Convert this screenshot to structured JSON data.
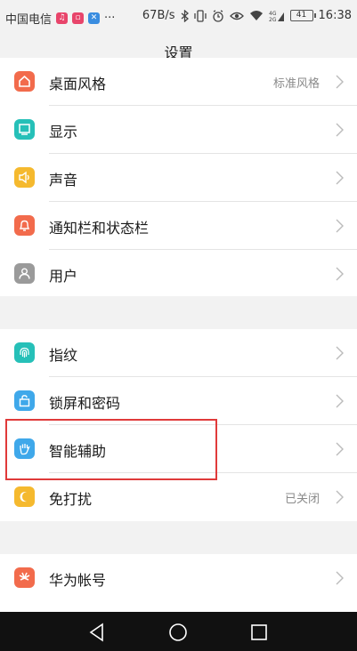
{
  "status_bar": {
    "carrier": "中国电信",
    "app_badges": [
      {
        "icon": "music-app-icon",
        "color": "#e8456b",
        "glyph": "♫"
      },
      {
        "icon": "camera-app-icon",
        "color": "#e8456b",
        "glyph": "▫"
      },
      {
        "icon": "tools-app-icon",
        "color": "#3a8de0",
        "glyph": "✕"
      }
    ],
    "more": "···",
    "net_speed": "67B/s",
    "battery_level": "41",
    "time": "16:38"
  },
  "header": {
    "title": "设置"
  },
  "groups": [
    {
      "items": [
        {
          "label": "桌面风格",
          "value": "标准风格",
          "icon": "home-icon",
          "color": "#f26b4c"
        },
        {
          "label": "显示",
          "value": "",
          "icon": "display-icon",
          "color": "#26c0b8"
        },
        {
          "label": "声音",
          "value": "",
          "icon": "speaker-icon",
          "color": "#f5b92e"
        },
        {
          "label": "通知栏和状态栏",
          "value": "",
          "icon": "bell-icon",
          "color": "#f26b4c"
        },
        {
          "label": "用户",
          "value": "",
          "icon": "user-icon",
          "color": "#9a9a9a"
        }
      ]
    },
    {
      "items": [
        {
          "label": "指纹",
          "value": "",
          "icon": "fingerprint-icon",
          "color": "#26c0b8"
        },
        {
          "label": "锁屏和密码",
          "value": "",
          "icon": "lock-icon",
          "color": "#3fa8ea"
        },
        {
          "label": "智能辅助",
          "value": "",
          "icon": "hand-icon",
          "color": "#3fa8ea"
        },
        {
          "label": "免打扰",
          "value": "已关闭",
          "icon": "moon-icon",
          "color": "#f5b92e"
        }
      ]
    },
    {
      "items": [
        {
          "label": "华为帐号",
          "value": "",
          "icon": "huawei-icon",
          "color": "#f26b4c"
        }
      ]
    }
  ],
  "highlight_color": "#e03a3a",
  "nav_bar": {
    "back": "back-icon",
    "home": "home-circle-icon",
    "recents": "recents-icon"
  }
}
